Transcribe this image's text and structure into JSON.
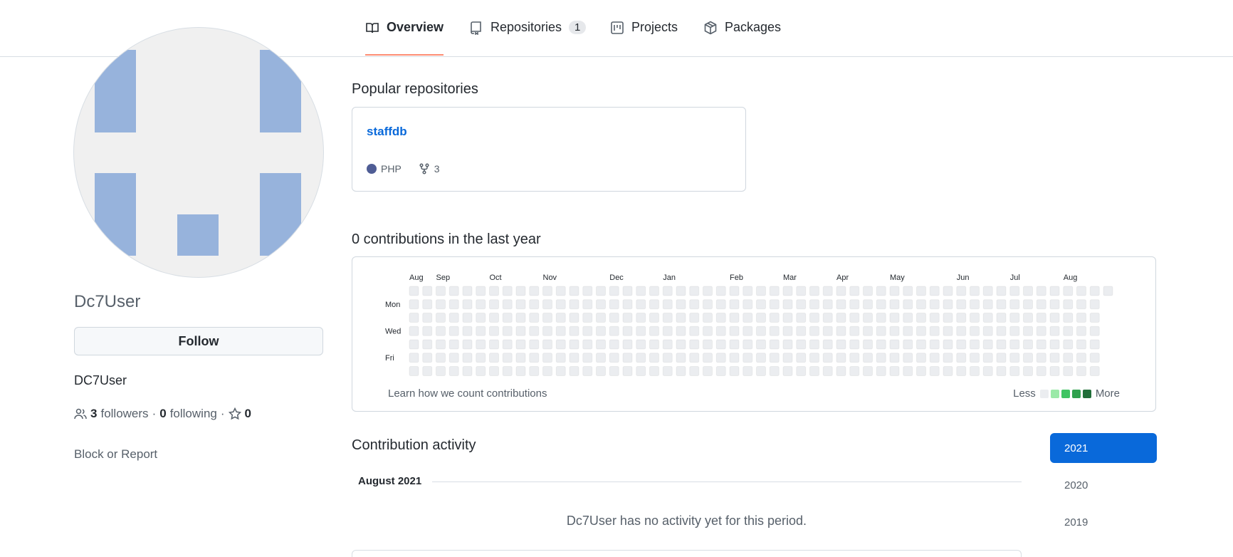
{
  "nav": {
    "tabs": [
      {
        "label": "Overview",
        "icon": "book-icon",
        "active": true
      },
      {
        "label": "Repositories",
        "icon": "repo-icon",
        "count": "1"
      },
      {
        "label": "Projects",
        "icon": "project-icon"
      },
      {
        "label": "Packages",
        "icon": "package-icon"
      }
    ]
  },
  "profile": {
    "username": "Dc7User",
    "display_name": "DC7User",
    "follow_label": "Follow",
    "followers_count": "3",
    "followers_label": "followers",
    "following_count": "0",
    "following_label": "following",
    "stars_count": "0",
    "block_report_label": "Block or Report",
    "avatar_colors": {
      "background": "#f0f0f0",
      "block": "#97b3dc"
    }
  },
  "popular": {
    "title": "Popular repositories",
    "repos": [
      {
        "name": "staffdb",
        "language": "PHP",
        "language_color": "#4f5d95",
        "forks": "3"
      }
    ]
  },
  "contributions": {
    "title": "0 contributions in the last year",
    "months": [
      "Aug",
      "Sep",
      "Oct",
      "Nov",
      "Dec",
      "Jan",
      "Feb",
      "Mar",
      "Apr",
      "May",
      "Jun",
      "Jul",
      "Aug"
    ],
    "day_labels": [
      "Mon",
      "Wed",
      "Fri"
    ],
    "weeks": 53,
    "total": 0,
    "empty_color": "#ebedf0",
    "learn_label": "Learn how we count contributions",
    "legend_less": "Less",
    "legend_more": "More",
    "legend_colors": [
      "#ebedf0",
      "#9be9a8",
      "#40c463",
      "#30a14e",
      "#216e39"
    ]
  },
  "activity": {
    "title": "Contribution activity",
    "month_heading": "August 2021",
    "empty_message": "Dc7User has no activity yet for this period.",
    "years": [
      "2021",
      "2020",
      "2019"
    ],
    "active_year": "2021"
  },
  "colors": {
    "accent": "#0969da",
    "tab_underline": "#fd8c73"
  }
}
